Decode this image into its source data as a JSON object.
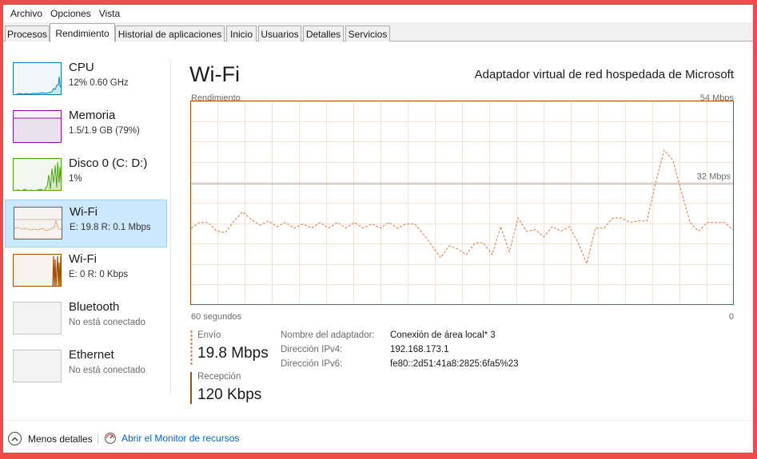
{
  "menu": [
    "Archivo",
    "Opciones",
    "Vista"
  ],
  "tabs": [
    {
      "label": "Procesos",
      "active": false
    },
    {
      "label": "Rendimiento",
      "active": true
    },
    {
      "label": "Historial de aplicaciones",
      "active": false
    },
    {
      "label": "Inicio",
      "active": false
    },
    {
      "label": "Usuarios",
      "active": false
    },
    {
      "label": "Detalles",
      "active": false
    },
    {
      "label": "Servicios",
      "active": false
    }
  ],
  "sidebar": {
    "items": [
      {
        "name": "CPU",
        "sub": "12%  0.60 GHz",
        "color": "#117dbb",
        "selected": false,
        "thumb": "cpu"
      },
      {
        "name": "Memoria",
        "sub": "1.5/1.9 GB (79%)",
        "color": "#8b12ae",
        "selected": false,
        "thumb": "mem"
      },
      {
        "name": "Disco 0 (C: D:)",
        "sub": "1%",
        "color": "#4da60c",
        "selected": false,
        "thumb": "disk"
      },
      {
        "name": "Wi-Fi",
        "sub": "E: 19.8  R: 0.1 Mbps",
        "color": "#a74f01",
        "selected": true,
        "thumb": "wifi1"
      },
      {
        "name": "Wi-Fi",
        "sub": "E: 0  R: 0 Kbps",
        "color": "#a74f01",
        "selected": false,
        "thumb": "wifi2"
      },
      {
        "name": "Bluetooth",
        "sub": "No está conectado",
        "color": "#c7c7c7",
        "selected": false,
        "thumb": "empty"
      },
      {
        "name": "Ethernet",
        "sub": "No está conectado",
        "color": "#c7c7c7",
        "selected": false,
        "thumb": "empty"
      }
    ]
  },
  "main": {
    "title": "Wi-Fi",
    "adapter": "Adaptador virtual de red hospedada de Microsoft",
    "graph_label": "Rendimiento",
    "graph_max": "54 Mbps",
    "graph_mid": "32 Mbps",
    "graph_time": "60 segundos",
    "graph_zero": "0",
    "send": {
      "label": "Envío",
      "value": "19.8 Mbps"
    },
    "receive": {
      "label": "Recepción",
      "value": "120 Kbps"
    },
    "properties": [
      {
        "label": "Nombre del adaptador:",
        "value": "Conexión de área local* 3"
      },
      {
        "label": "Dirección IPv4:",
        "value": "192.168.173.1"
      },
      {
        "label": "Dirección IPv6:",
        "value": "fe80::2d51:41a8:2825:6fa5%23"
      }
    ]
  },
  "footer": {
    "less_details": "Menos detalles",
    "open_monitor": "Abrir el Monitor de recursos"
  },
  "chart_data": {
    "type": "line",
    "title": "",
    "ylabel": "Rendimiento",
    "ylim": [
      0,
      54
    ],
    "ylim_label": "54 Mbps",
    "reference_line": 32,
    "reference_label": "32 Mbps",
    "xlabel": "60 segundos",
    "series": [
      {
        "name": "Envío",
        "color": "#e07a3e",
        "style": "dashed",
        "values": [
          20.3,
          21.8,
          21.8,
          19.5,
          19.1,
          22.2,
          24.6,
          22.6,
          21.1,
          22.2,
          20.7,
          21.8,
          20.3,
          21.4,
          20.3,
          21.8,
          20.3,
          21.8,
          20.3,
          21.8,
          20.3,
          21.4,
          20.3,
          21.8,
          20.3,
          21.4,
          21.4,
          18.7,
          15.6,
          12.5,
          15.6,
          14.8,
          13.3,
          16.4,
          16.4,
          13.3,
          20.7,
          14.0,
          23.0,
          19.5,
          19.9,
          18.0,
          20.7,
          19.5,
          20.7,
          16.4,
          10.9,
          20.3,
          20.3,
          22.9,
          23.0,
          21.8,
          22.2,
          22.2,
          32.3,
          40.9,
          38.2,
          30.0,
          21.8,
          19.5,
          21.8,
          21.8,
          21.8,
          19.9
        ]
      }
    ]
  }
}
